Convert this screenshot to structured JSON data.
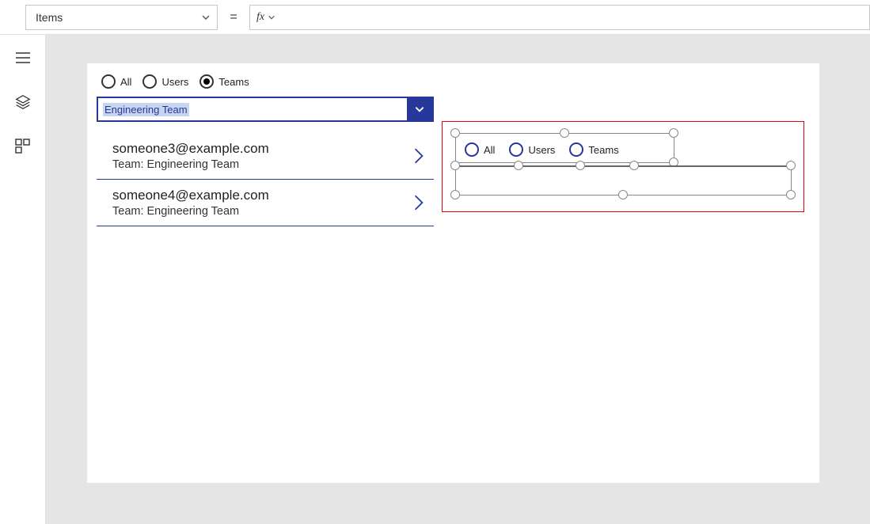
{
  "formula_bar": {
    "property_label": "Items",
    "equals": "=",
    "fx_label": "fx"
  },
  "left_screen": {
    "radios": {
      "all": "All",
      "users": "Users",
      "teams": "Teams",
      "selected": "teams"
    },
    "dropdown_value": "Engineering Team",
    "list": [
      {
        "primary": "someone3@example.com",
        "secondary": "Team: Engineering Team"
      },
      {
        "primary": "someone4@example.com",
        "secondary": "Team: Engineering Team"
      }
    ]
  },
  "right_preview": {
    "radios": {
      "all": "All",
      "users": "Users",
      "teams": "Teams"
    }
  }
}
